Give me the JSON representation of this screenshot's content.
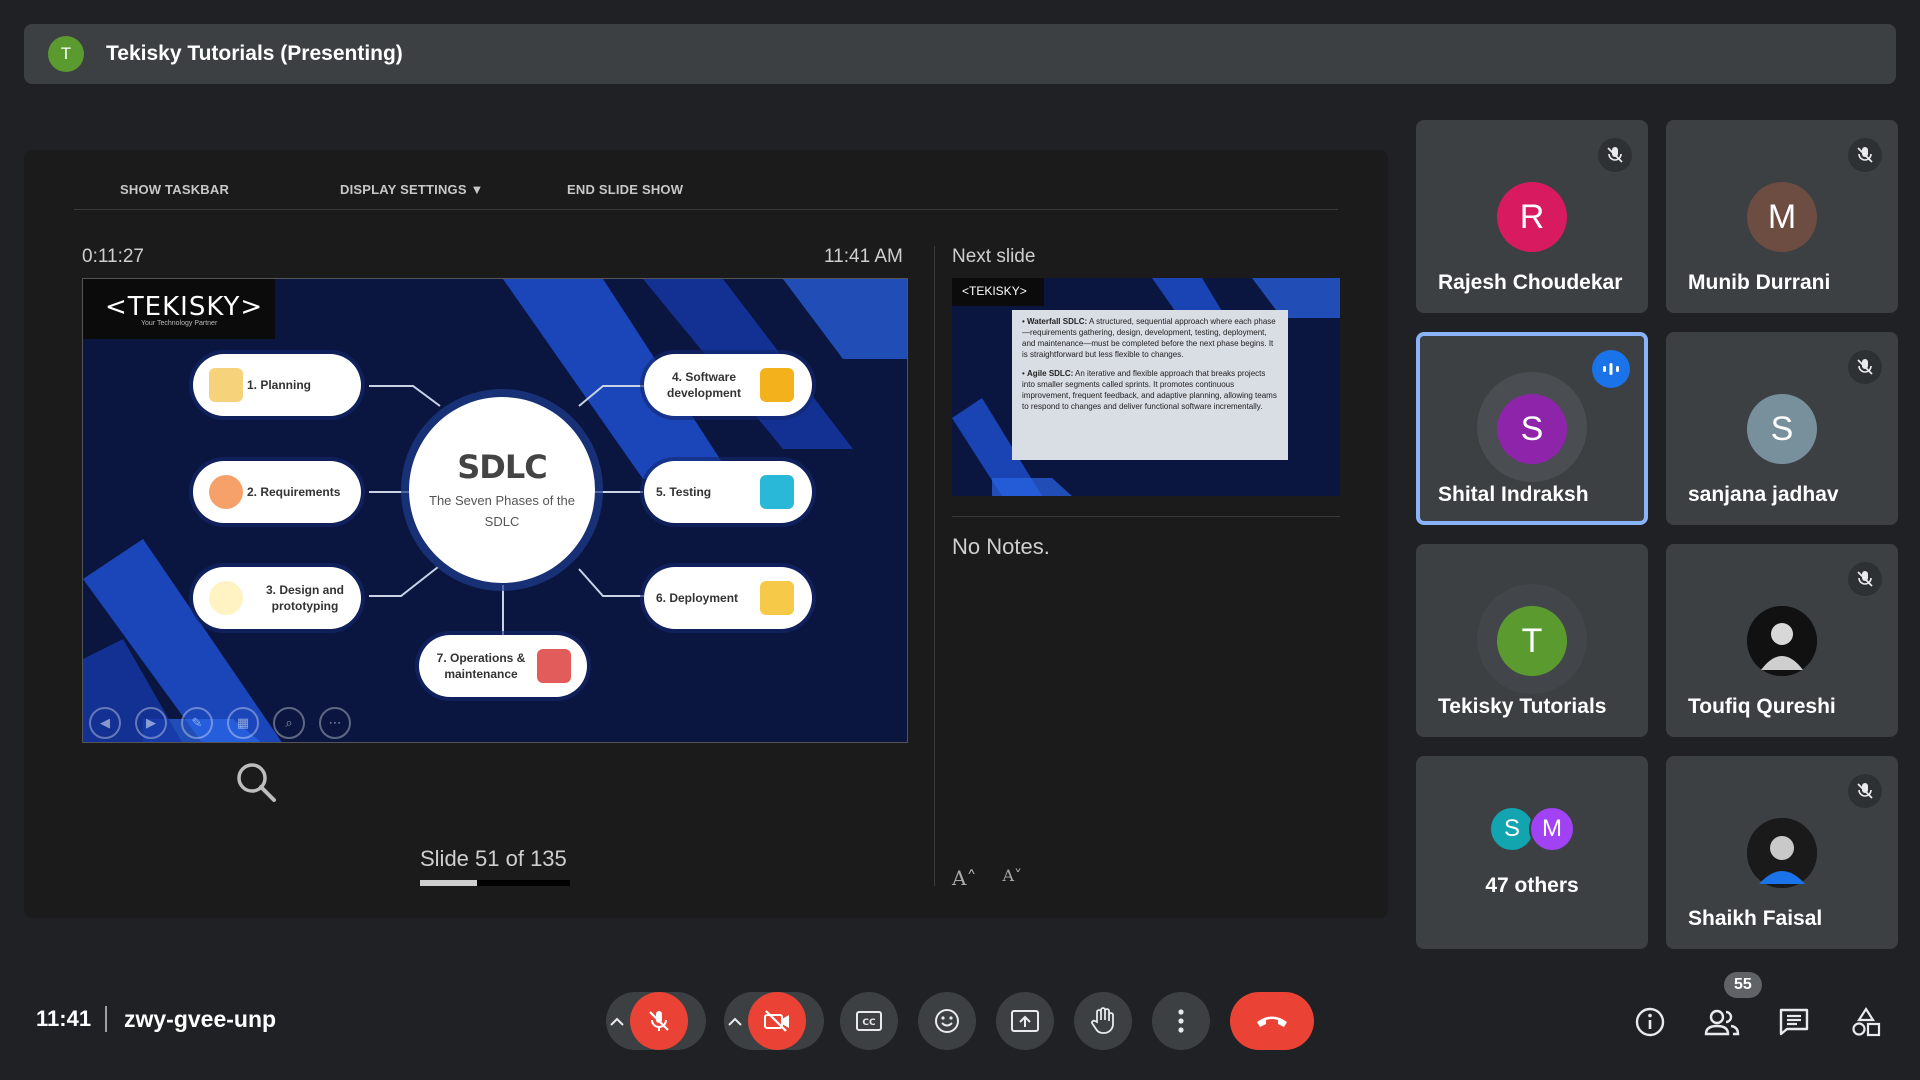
{
  "presenter_bar": {
    "avatar_letter": "T",
    "title": "Tekisky Tutorials (Presenting)"
  },
  "presenter_view": {
    "toolbar": {
      "show_taskbar": "SHOW TASKBAR",
      "display_settings": "DISPLAY SETTINGS ▼",
      "end_slide_show": "END SLIDE SHOW"
    },
    "timer": "0:11:27",
    "clock": "11:41 AM",
    "next_slide_label": "Next slide",
    "notes": "No Notes.",
    "slide_counter": "Slide 51 of 135",
    "progress_fraction": 0.378
  },
  "slide": {
    "logo": "<TEKISKY>",
    "logo_tagline": "Your Technology Partner",
    "center_title": "SDLC",
    "center_subtitle": "The Seven Phases of the SDLC",
    "phases": [
      "1. Planning",
      "2. Requirements",
      "3. Design and prototyping",
      "4. Software development",
      "5. Testing",
      "6. Deployment",
      "7. Operations & maintenance"
    ]
  },
  "next_slide": {
    "logo": "<TEKISKY>",
    "bullet1_title": "Waterfall SDLC:",
    "bullet1_text": "A structured, sequential approach where each phase—requirements gathering, design, development, testing, deployment, and maintenance—must be completed before the next phase begins. It is straightforward but less flexible to changes.",
    "bullet2_title": "Agile SDLC:",
    "bullet2_text": "An iterative and flexible approach that breaks projects into smaller segments called sprints. It promotes continuous improvement, frequent feedback, and adaptive planning, allowing teams to respond to changes and deliver functional software incrementally."
  },
  "participants": [
    {
      "name": "Rajesh Choudekar",
      "letter": "R",
      "color": "#d81b60",
      "muted": true
    },
    {
      "name": "Munib Durrani",
      "letter": "M",
      "color": "#6d4c41",
      "muted": true
    },
    {
      "name": "Shital Indraksh",
      "letter": "S",
      "color": "#8e24aa",
      "speaking": true
    },
    {
      "name": "sanjana jadhav",
      "letter": "S",
      "color": "#78909c",
      "muted": true
    },
    {
      "name": "Tekisky Tutorials",
      "letter": "T",
      "color": "#5b9a2f"
    },
    {
      "name": "Toufiq Qureshi",
      "muted": true
    },
    {
      "others_label": "47 others",
      "letters": [
        "S",
        "M"
      ],
      "colors": [
        "#12a4af",
        "#a142f4"
      ]
    },
    {
      "name": "Shaikh Faisal",
      "muted": true
    }
  ],
  "bottom_bar": {
    "time": "11:41",
    "meeting_code": "zwy-gvee-unp",
    "participant_count": "55",
    "colors": {
      "danger": "#ea4335",
      "control_bg": "#3c4043",
      "accent": "#8ab4f8"
    }
  }
}
